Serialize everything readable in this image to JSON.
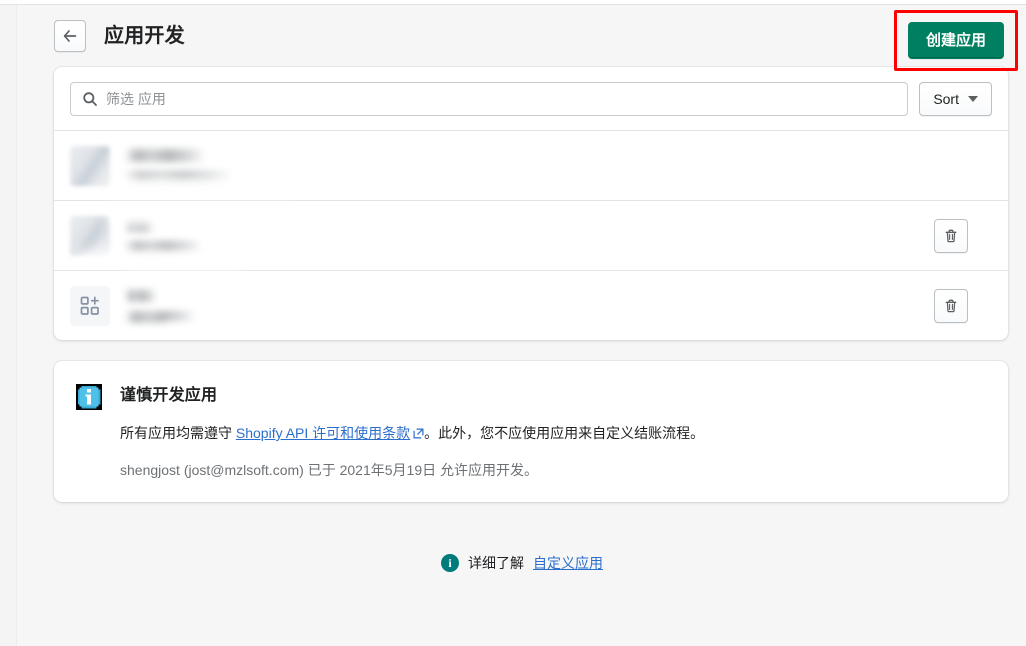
{
  "header": {
    "back_label": "←",
    "title": "应用开发",
    "create_button": "创建应用"
  },
  "filters": {
    "search_placeholder": "筛选 应用",
    "search_value": "",
    "sort_label": "Sort"
  },
  "apps": [
    {
      "name": "",
      "subtitle": "",
      "icon": "blurred-app-icon",
      "has_delete": false
    },
    {
      "name": "",
      "subtitle": "",
      "icon": "blurred-app-icon",
      "has_delete": true,
      "delete_label": ""
    },
    {
      "name": "",
      "subtitle": "",
      "icon": "grid-plus-icon",
      "has_delete": true,
      "delete_label": ""
    }
  ],
  "notice": {
    "icon": "info-icon",
    "title": "谨慎开发应用",
    "text_before_link": "所有应用均需遵守 ",
    "link_text": "Shopify API 许可和使用条款",
    "text_after_link": "。此外，您不应使用应用来自定义结账流程。",
    "meta": "shengjost (jost@mzlsoft.com) 已于 2021年5月19日 允许应用开发。"
  },
  "footer": {
    "icon": "info-circle-icon",
    "text": "详细了解 ",
    "link_text": "自定义应用"
  },
  "colors": {
    "primary_button": "#008060",
    "highlight_box": "#ff0000",
    "link": "#2c6ecb",
    "page_background": "#f6f6f7",
    "footer_icon": "#007b7b"
  }
}
